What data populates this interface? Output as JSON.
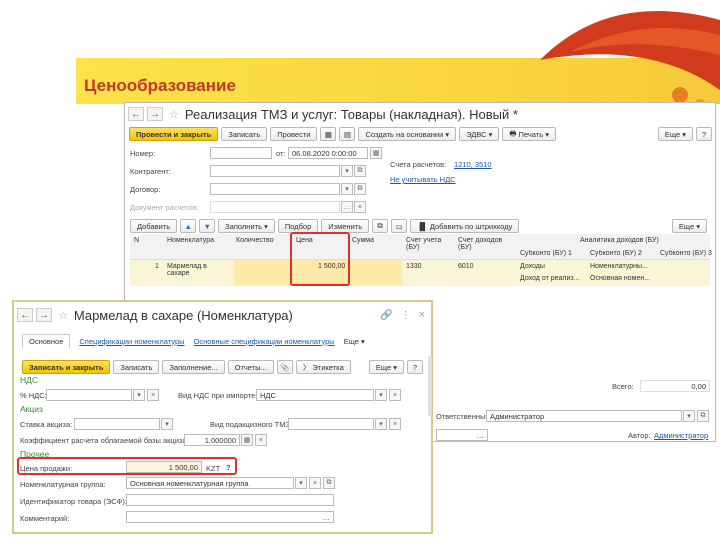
{
  "slide": {
    "title": "Ценообразование"
  },
  "doc": {
    "title": "Реализация ТМЗ и услуг: Товары (накладная). Новый *",
    "toolbar": {
      "post_close": "Провести и закрыть",
      "save": "Записать",
      "post": "Провести",
      "create_based": "Создать на основании",
      "edvs": "ЭДВС",
      "print": "Печать",
      "more": "Еще",
      "help": "?"
    },
    "fields": {
      "number_label": "Номер:",
      "date_label": "от:",
      "date_value": "06.08.2020  0:00:00",
      "contractor_label": "Контрагент:",
      "contract_label": "Договор:",
      "calc_doc_label": "Документ расчетов:",
      "accounts_label": "Счета расчетов:",
      "accounts_value": "1210, 3510",
      "vat_link": "Не учитывать НДС"
    },
    "table_toolbar": {
      "add": "Добавить",
      "fill": "Заполнить",
      "select": "Подбор",
      "change": "Изменить",
      "barcode": "Добавить по штрихкоду",
      "more": "Еще"
    },
    "columns": {
      "n": "N",
      "nomenclature": "Номенклатура",
      "quantity": "Количество",
      "price": "Цена",
      "sum": "Сумма",
      "acc_bu": "Счет учета (БУ)",
      "acc_income": "Счет доходов (БУ)",
      "analytics": "Аналитика доходов (БУ)",
      "sub1": "Субконто (БУ) 1",
      "sub2": "Субконто (БУ) 2",
      "sub3": "Субконто (БУ) 3"
    },
    "row": {
      "n": "1",
      "nomenclature": "Мармелад в сахаре",
      "price": "1 500,00",
      "acc_bu": "1330",
      "acc_income": "6010",
      "sub1a": "Доходы",
      "sub1b": "Доход от реализ...",
      "sub2a": "Номенклатурны...",
      "sub2b": "Основная номен..."
    },
    "footer": {
      "total_label": "Всего:",
      "total_value": "0,00",
      "responsible_label": "Ответственный:",
      "responsible_value": "Администратор",
      "author_label": "Автор:",
      "author_value": "Администратор"
    }
  },
  "card": {
    "title": "Мармелад в сахаре (Номенклатура)",
    "tabs": [
      "Основное",
      "Спецификации номенклатуры",
      "Основные спецификации номенклатуры",
      "Еще"
    ],
    "toolbar": {
      "save_close": "Записать и закрыть",
      "save": "Записать",
      "fill": "Заполнение...",
      "reports": "Отчеты...",
      "label": "Этикетка",
      "more": "Еще",
      "help": "?"
    },
    "vat": {
      "section": "НДС",
      "rate_label": "% НДС:",
      "import_label": "Вид НДС при импорте:",
      "import_value": "НДС"
    },
    "excise": {
      "section": "Акциз",
      "rate_label": "Ставка акциза:",
      "type_label": "Вид подакцизного ТМЗ:",
      "coef_label": "Коэффициент расчета облагаемой базы акциза:",
      "coef_value": "1,000000"
    },
    "other": {
      "section": "Прочее",
      "price_label": "Цена продажи:",
      "price_value": "1 500,00",
      "currency": "KZT",
      "help": "?",
      "group_label": "Номенклатурная группа:",
      "group_value": "Основная номенклатурная группа",
      "id_label": "Идентификатор товара (ЭСФ):",
      "comment_label": "Комментарий:"
    }
  },
  "colors": {
    "accent_yellow": "#f5c400",
    "section_green": "#3a8a3a",
    "highlight_red": "#e03030",
    "link_blue": "#1a5aa8"
  }
}
